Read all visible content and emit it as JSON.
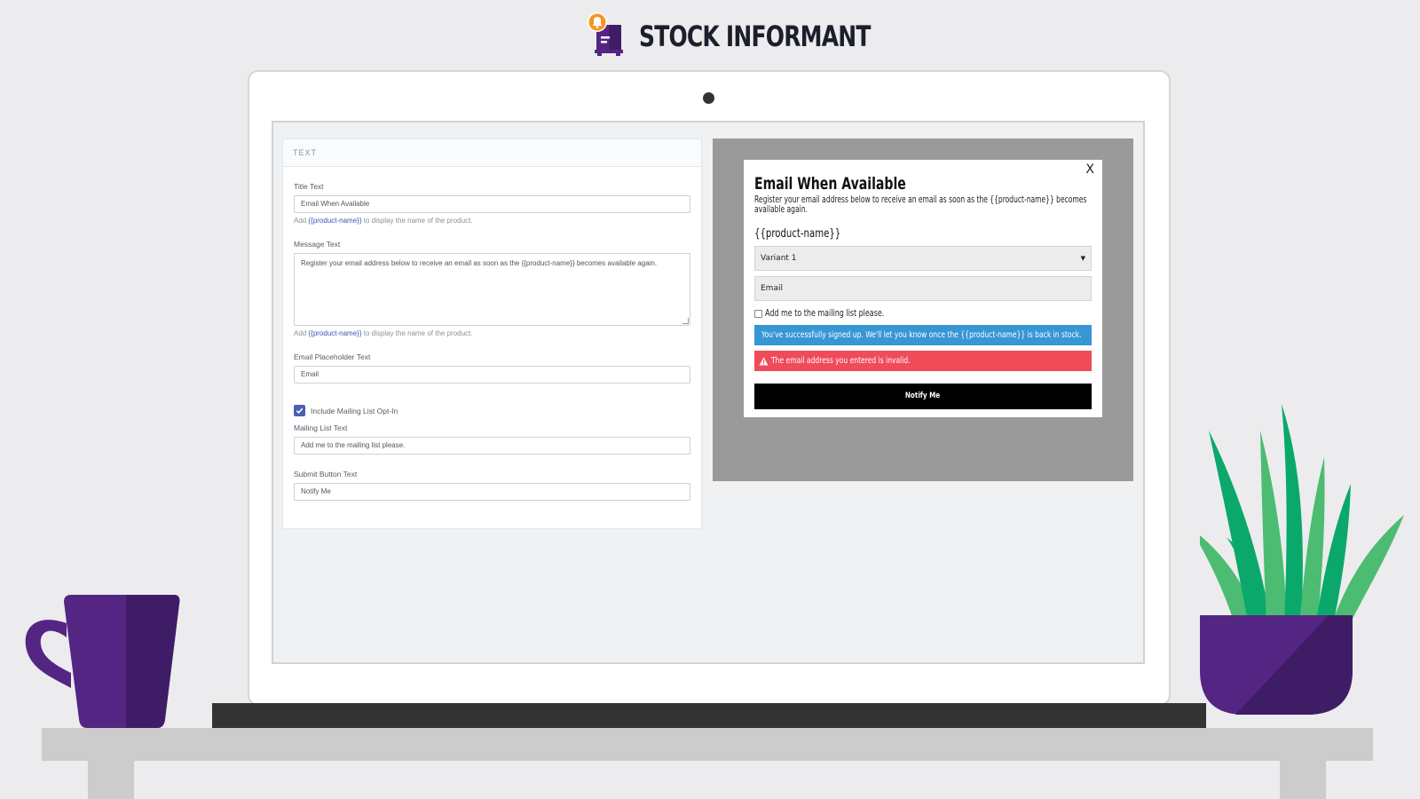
{
  "brand": {
    "name": "STOCK INFORMANT"
  },
  "colors": {
    "brand_purple": "#552583",
    "accent_orange": "#f7941d",
    "success": "#3796d4",
    "error": "#f04b59",
    "plant_green": "#0aa86b"
  },
  "settings": {
    "section_title": "TEXT",
    "title_label": "Title Text",
    "title_value": "Email When Available",
    "title_help_prefix": "Add",
    "title_help_token": "{{product-name}}",
    "title_help_suffix": "to display the name of the product.",
    "message_label": "Message Text",
    "message_value": "Register your email address below to receive an email as soon as the {{product-name}} becomes available again.",
    "message_help_prefix": "Add",
    "message_help_token": "{{product-name}}",
    "message_help_suffix": "to display the name of the product.",
    "email_placeholder_label": "Email Placeholder Text",
    "email_placeholder_value": "Email",
    "mailing_optin_label": "Include Mailing List Opt-In",
    "mailing_optin_checked": true,
    "mailing_text_label": "Mailing List Text",
    "mailing_text_value": "Add me to the mailing list please.",
    "submit_label": "Submit Button Text",
    "submit_value": "Notify Me"
  },
  "preview": {
    "close_label": "X",
    "title": "Email When Available",
    "message": "Register your email address below to receive an email as soon as the {{product-name}} becomes available again.",
    "product_name": "{{product-name}}",
    "variant_selected": "Variant 1",
    "email_placeholder": "Email",
    "optin_label": "Add me to the mailing list please.",
    "success_message": "You've successfully signed up. We'll let you know once the {{product-name}} is back in stock.",
    "error_message": "The email address you entered is invalid.",
    "button_label": "Notify Me"
  }
}
